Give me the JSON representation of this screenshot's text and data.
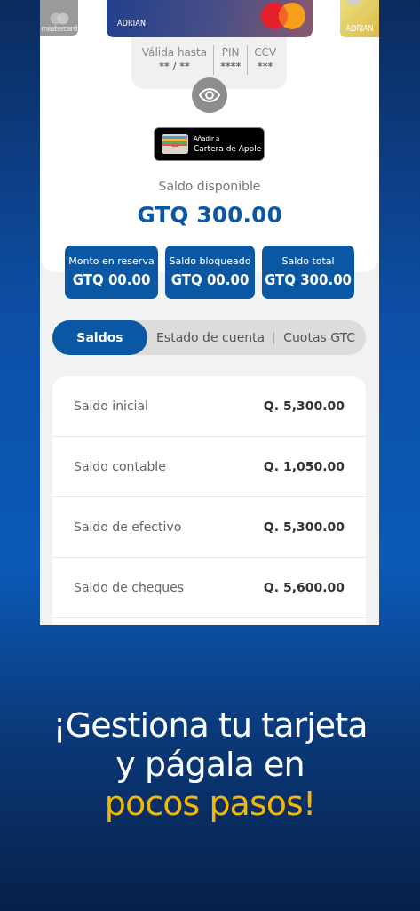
{
  "cards": [
    {
      "kind": "silver",
      "text": "mastercard"
    },
    {
      "kind": "main",
      "text": "ADRIAN"
    },
    {
      "kind": "gold",
      "text": "ADRIAN"
    }
  ],
  "card_details": [
    {
      "label": "Válida hasta",
      "value": "** / **"
    },
    {
      "label": "PIN",
      "value": "****"
    },
    {
      "label": "CCV",
      "value": "***"
    }
  ],
  "wallet_button": {
    "line_1": "Añadir a",
    "line_2": "Cartera de Apple"
  },
  "available_balance": {
    "label": "Saldo disponible",
    "value": "GTQ 300.00"
  },
  "summary": [
    {
      "label": "Monto en reserva",
      "value": "GTQ 00.00"
    },
    {
      "label": "Saldo bloqueado",
      "value": "GTQ 00.00"
    },
    {
      "label": "Saldo total",
      "value": "GTQ 300.00"
    }
  ],
  "tabs": [
    {
      "label": "Saldos",
      "selected": true
    },
    {
      "label": "Estado de cuenta",
      "selected": false
    },
    {
      "label": "Cuotas GTC",
      "selected": false
    }
  ],
  "balances": [
    {
      "label": "Saldo inicial",
      "value": "Q. 5,300.00"
    },
    {
      "label": "Saldo contable",
      "value": "Q. 1,050.00"
    },
    {
      "label": "Saldo de efectivo",
      "value": "Q. 5,300.00"
    },
    {
      "label": "Saldo de cheques",
      "value": "Q. 5,600.00"
    }
  ],
  "headline": {
    "line_1": "¡Gestiona tu tarjeta",
    "line_2": "y págala en",
    "line_3": "pocos pasos!"
  }
}
